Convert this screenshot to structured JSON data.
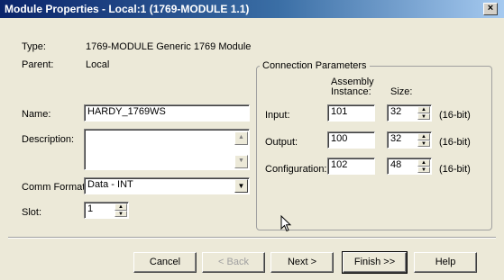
{
  "window": {
    "title": "Module Properties  - Local:1 (1769-MODULE 1.1)",
    "close_glyph": "×"
  },
  "info": {
    "type_label": "Type:",
    "type_value": "1769-MODULE Generic 1769 Module",
    "parent_label": "Parent:",
    "parent_value": "Local"
  },
  "form": {
    "name_label": "Name:",
    "name_value": "HARDY_1769WS",
    "description_label": "Description:",
    "description_value": "",
    "comm_format_label": "Comm Format:",
    "comm_format_value": "Data - INT",
    "slot_label": "Slot:",
    "slot_value": "1"
  },
  "connection": {
    "group_title": "Connection Parameters",
    "assembly_header_line1": "Assembly",
    "assembly_header_line2": "Instance:",
    "size_header": "Size:",
    "rows": [
      {
        "label": "Input:",
        "instance": "101",
        "size": "32",
        "unit": "(16-bit)"
      },
      {
        "label": "Output:",
        "instance": "100",
        "size": "32",
        "unit": "(16-bit)"
      },
      {
        "label": "Configuration:",
        "instance": "102",
        "size": "48",
        "unit": "(16-bit)"
      }
    ]
  },
  "buttons": {
    "cancel": "Cancel",
    "back": "< Back",
    "next": "Next >",
    "finish": "Finish >>",
    "help": "Help"
  }
}
